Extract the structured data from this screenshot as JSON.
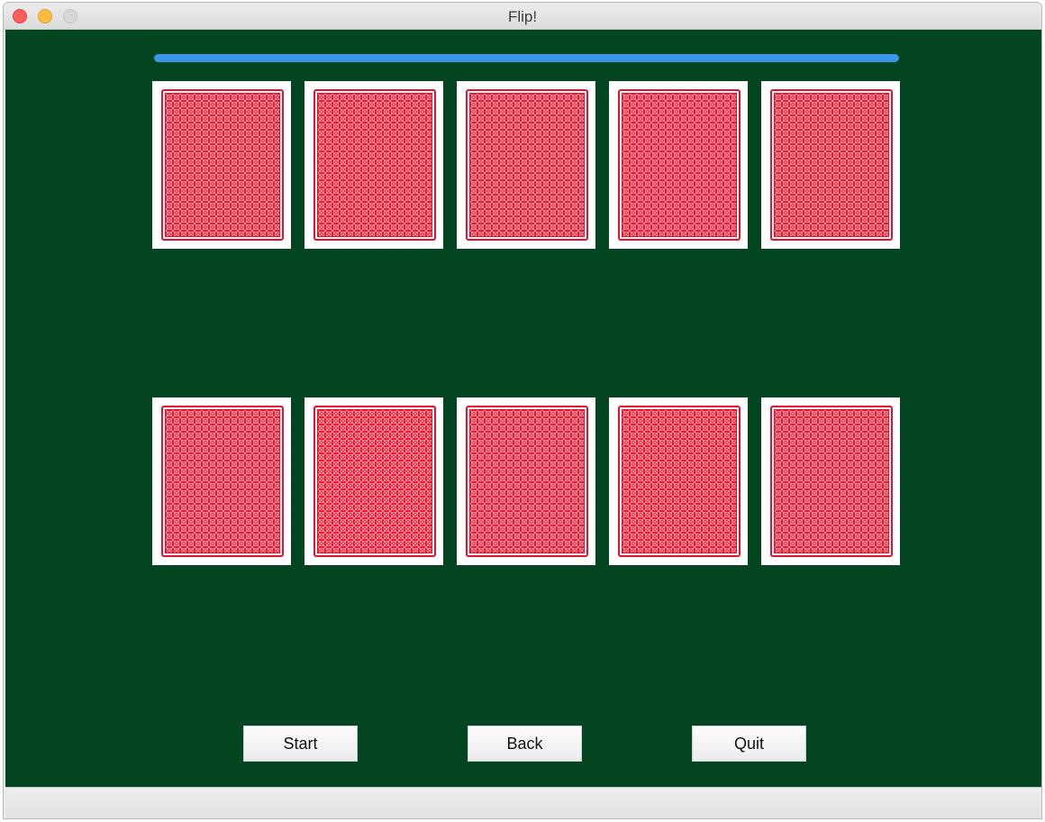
{
  "window": {
    "title": "Flip!"
  },
  "progress": {
    "value_percent": 100,
    "color": "#3b95e8"
  },
  "board": {
    "felt_color": "#024520",
    "card_back_color": "#e8102a",
    "rows": [
      [
        "card-back",
        "card-back",
        "card-back",
        "card-back",
        "card-back"
      ],
      [
        "card-back",
        "card-back",
        "card-back",
        "card-back",
        "card-back"
      ]
    ]
  },
  "buttons": {
    "start": "Start",
    "back": "Back",
    "quit": "Quit"
  }
}
